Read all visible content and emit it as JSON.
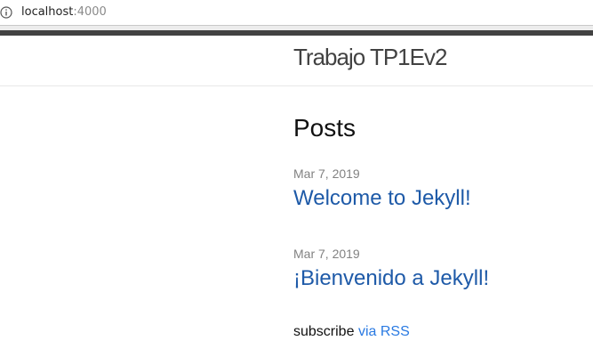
{
  "browser": {
    "url_host": "localhost",
    "url_port": ":4000",
    "info_icon": "info-icon"
  },
  "site": {
    "title": "Trabajo TP1Ev2"
  },
  "main": {
    "heading": "Posts",
    "posts": [
      {
        "date": "Mar 7, 2019",
        "title": "Welcome to Jekyll!"
      },
      {
        "date": "Mar 7, 2019",
        "title": "¡Bienvenido a Jekyll!"
      }
    ],
    "rss": {
      "prefix": "subscribe",
      "link": "via RSS"
    }
  },
  "colors": {
    "header_border": "#424242",
    "link": "#2a7ae2",
    "post_link": "#1e5aa8",
    "meta": "#828282"
  }
}
